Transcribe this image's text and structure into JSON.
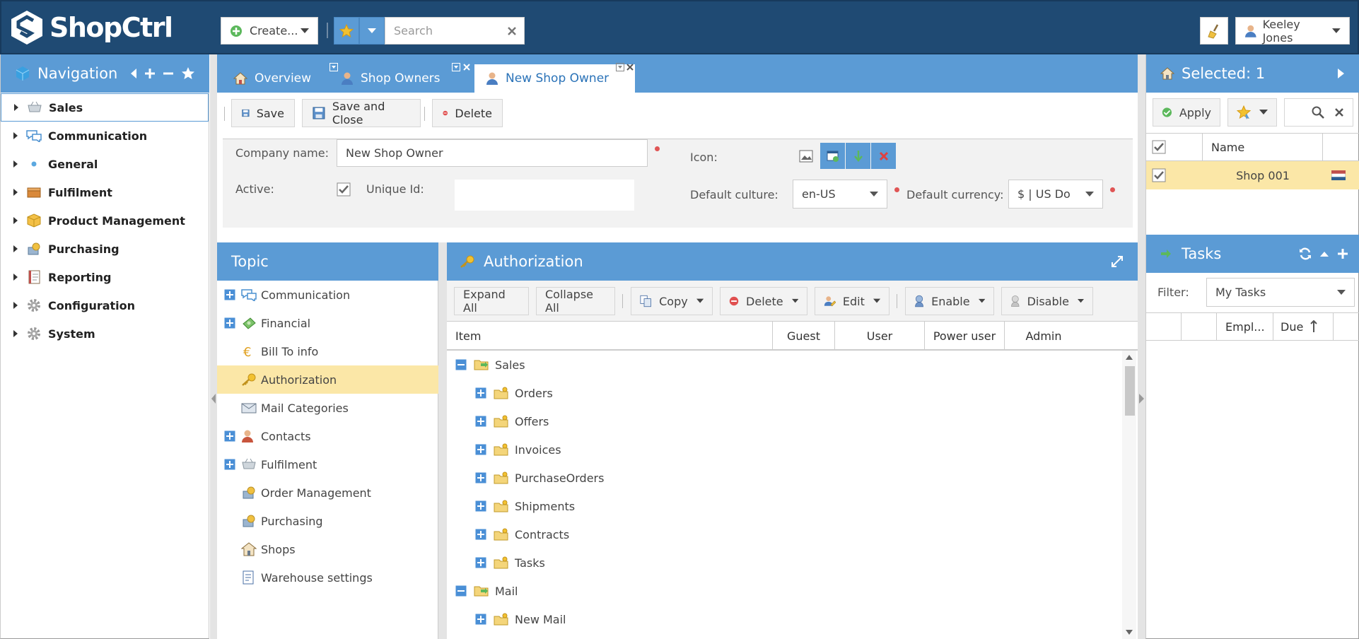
{
  "app": {
    "name": "ShopCtrl"
  },
  "header": {
    "create_label": "Create...",
    "search_placeholder": "Search",
    "user_name": "Keeley Jones"
  },
  "navigation": {
    "title": "Navigation",
    "items": [
      {
        "label": "Sales",
        "icon": "cart-icon",
        "selected": true
      },
      {
        "label": "Communication",
        "icon": "chat-icon"
      },
      {
        "label": "General",
        "icon": "dot-icon"
      },
      {
        "label": "Fulfilment",
        "icon": "box-icon"
      },
      {
        "label": "Product Management",
        "icon": "package-icon"
      },
      {
        "label": "Purchasing",
        "icon": "purchasing-icon"
      },
      {
        "label": "Reporting",
        "icon": "report-icon"
      },
      {
        "label": "Configuration",
        "icon": "gear-icon"
      },
      {
        "label": "System",
        "icon": "gear-icon"
      }
    ]
  },
  "tabs": [
    {
      "label": "Overview",
      "icon": "home-icon"
    },
    {
      "label": "Shop Owners",
      "icon": "user-icon"
    },
    {
      "label": "New Shop Owner",
      "icon": "user-icon",
      "active": true
    }
  ],
  "toolbar": {
    "save": "Save",
    "save_close": "Save and Close",
    "delete": "Delete"
  },
  "form": {
    "company_name_label": "Company name:",
    "company_name_value": "New Shop Owner",
    "active_label": "Active:",
    "unique_id_label": "Unique Id:",
    "unique_id_value": "",
    "icon_label": "Icon:",
    "default_culture_label": "Default culture:",
    "default_culture_value": "en-US",
    "default_currency_label": "Default currency:",
    "default_currency_value": "$ | US Do"
  },
  "topic": {
    "title": "Topic",
    "items": [
      {
        "label": "Communication",
        "expandable": true,
        "icon": "chat-icon"
      },
      {
        "label": "Financial",
        "expandable": true,
        "icon": "money-icon"
      },
      {
        "label": "Bill To info",
        "expandable": false,
        "icon": "euro-icon"
      },
      {
        "label": "Authorization",
        "expandable": false,
        "icon": "key-icon",
        "selected": true
      },
      {
        "label": "Mail Categories",
        "expandable": false,
        "icon": "mail-icon"
      },
      {
        "label": "Contacts",
        "expandable": true,
        "icon": "user-icon"
      },
      {
        "label": "Fulfilment",
        "expandable": true,
        "icon": "cart-icon"
      },
      {
        "label": "Order Management",
        "expandable": false,
        "icon": "order-icon"
      },
      {
        "label": "Purchasing",
        "expandable": false,
        "icon": "purchasing-icon"
      },
      {
        "label": "Shops",
        "expandable": false,
        "icon": "shop-icon"
      },
      {
        "label": "Warehouse settings",
        "expandable": false,
        "icon": "doc-icon"
      }
    ]
  },
  "authorization": {
    "title": "Authorization",
    "buttons": {
      "expand_all": "Expand All",
      "collapse_all": "Collapse All",
      "copy": "Copy",
      "delete": "Delete",
      "edit": "Edit",
      "enable": "Enable",
      "disable": "Disable"
    },
    "columns": [
      "Item",
      "Guest",
      "User",
      "Power user",
      "Admin"
    ],
    "rows": [
      {
        "label": "Sales",
        "level": 0,
        "expanded": true
      },
      {
        "label": "Orders",
        "level": 1
      },
      {
        "label": "Offers",
        "level": 1
      },
      {
        "label": "Invoices",
        "level": 1
      },
      {
        "label": "PurchaseOrders",
        "level": 1
      },
      {
        "label": "Shipments",
        "level": 1
      },
      {
        "label": "Contracts",
        "level": 1
      },
      {
        "label": "Tasks",
        "level": 1
      },
      {
        "label": "Mail",
        "level": 0,
        "expanded": true
      },
      {
        "label": "New Mail",
        "level": 1
      }
    ]
  },
  "selected_panel": {
    "title": "Selected: 1",
    "apply": "Apply",
    "column_name": "Name",
    "rows": [
      {
        "name": "Shop 001",
        "checked": true
      }
    ]
  },
  "tasks_panel": {
    "title": "Tasks",
    "filter_label": "Filter:",
    "filter_value": "My Tasks",
    "columns": [
      "Empl...",
      "Due"
    ]
  },
  "colors": {
    "header": "#1f4a73",
    "accent": "#5b9bd5",
    "selected_row": "#fbe7a7"
  }
}
